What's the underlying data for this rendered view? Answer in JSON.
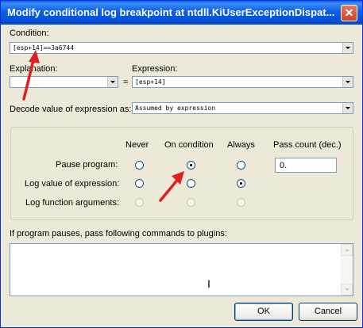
{
  "window": {
    "title": "Modify conditional log breakpoint at ntdll.KiUserExceptionDispat..."
  },
  "condition": {
    "label": "Condition:",
    "value": "[esp+14]==3a6744"
  },
  "explanation": {
    "label": "Explanation:",
    "value": ""
  },
  "equals_sign": "=",
  "expression": {
    "label": "Expression:",
    "value": "[esp+14]"
  },
  "decode": {
    "label": "Decode value of expression as:",
    "value": "Assumed by expression"
  },
  "options": {
    "columns": [
      "Never",
      "On condition",
      "Always",
      "Pass count (dec.)"
    ],
    "rows": [
      {
        "label": "Pause program:",
        "selected": "On condition",
        "enabled": true
      },
      {
        "label": "Log value of expression:",
        "selected": "Always",
        "enabled": true
      },
      {
        "label": "Log function arguments:",
        "selected": "",
        "enabled": false
      }
    ],
    "pass_count": "0."
  },
  "plugins": {
    "label": "If program pauses, pass following commands to plugins:",
    "value": ""
  },
  "buttons": {
    "ok": "OK",
    "cancel": "Cancel"
  },
  "colors": {
    "annotation_arrow": "#E02020",
    "title_bar": "#0A60E8",
    "dialog_bg": "#ECE9D8"
  }
}
